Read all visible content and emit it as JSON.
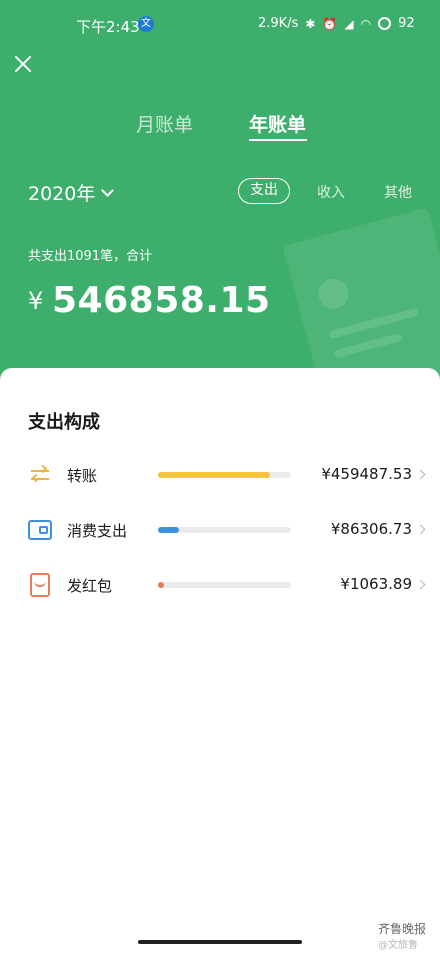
{
  "status_bar": {
    "time": "下午2:43",
    "app_icon_glyph": "文",
    "network_speed": "2.9K/s",
    "battery": "92"
  },
  "tabs": [
    {
      "label": "月账单",
      "active": false
    },
    {
      "label": "年账单",
      "active": true
    }
  ],
  "year_selector": {
    "value": "2020年"
  },
  "filters": [
    {
      "label": "支出",
      "selected": true
    },
    {
      "label": "收入",
      "selected": false
    },
    {
      "label": "其他",
      "selected": false
    }
  ],
  "summary": {
    "text": "共支出1091笔，合计",
    "currency": "¥",
    "total": "546858.15"
  },
  "breakdown": {
    "title": "支出构成",
    "items": [
      {
        "label": "转账",
        "amount": "¥459487.53",
        "icon": "transfer-icon",
        "share": 0.84,
        "color": "#f5c242"
      },
      {
        "label": "消费支出",
        "amount": "¥86306.73",
        "icon": "wallet-icon",
        "share": 0.16,
        "color": "#3d8fe0"
      },
      {
        "label": "发红包",
        "amount": "¥1063.89",
        "icon": "red-packet-icon",
        "share": 0.002,
        "color": "#e67a5c"
      }
    ]
  },
  "watermark": {
    "text": "齐鲁晚报",
    "sub": "@文旅鲁"
  },
  "colors": {
    "brand_green": "#3dae6b"
  }
}
